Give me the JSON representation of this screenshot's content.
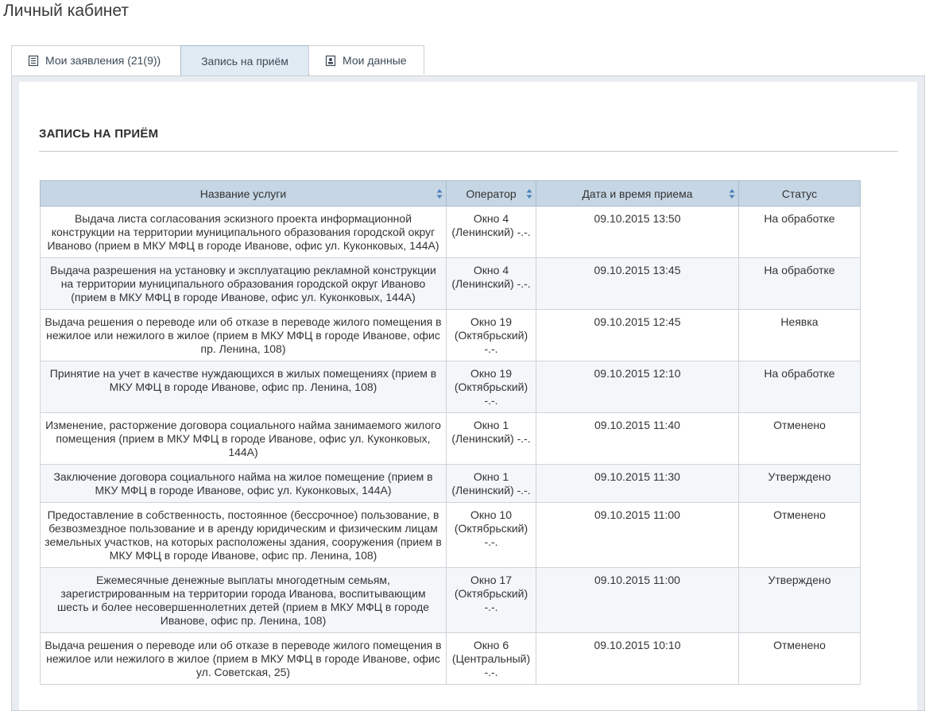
{
  "page": {
    "title": "Личный кабинет"
  },
  "tabs": [
    {
      "label": "Мои заявления (21(9))",
      "icon": "document-list-icon",
      "active": false
    },
    {
      "label": "Запись на приём",
      "icon": "",
      "active": true
    },
    {
      "label": "Мои данные",
      "icon": "id-card-icon",
      "active": false
    }
  ],
  "section": {
    "title": "ЗАПИСЬ НА ПРИЁМ"
  },
  "table": {
    "headers": [
      {
        "label": "Название услуги",
        "sortable": true
      },
      {
        "label": "Оператор",
        "sortable": true
      },
      {
        "label": "Дата и время приема",
        "sortable": true
      },
      {
        "label": "Статус",
        "sortable": false
      }
    ],
    "rows": [
      {
        "service": "Выдача листа согласования эскизного проекта информационной конструкции на территории муниципального образования городской округ Иваново (прием в МКУ МФЦ в городе Иванове, офис ул. Куконковых, 144А)",
        "operator": "Окно 4 (Ленинский) -.-.",
        "datetime": "09.10.2015 13:50",
        "status": "На обработке"
      },
      {
        "service": "Выдача разрешения на установку и эксплуатацию рекламной конструкции на территории муниципального образования городской округ Иваново (прием в МКУ МФЦ в городе Иванове, офис ул. Куконковых, 144А)",
        "operator": "Окно 4 (Ленинский) -.-.",
        "datetime": "09.10.2015 13:45",
        "status": "На обработке"
      },
      {
        "service": "Выдача решения о переводе или об отказе в переводе жилого помещения в нежилое или нежилого в жилое (прием в МКУ МФЦ в городе Иванове, офис пр. Ленина, 108)",
        "operator": "Окно 19 (Октябрьский) -.-.",
        "datetime": "09.10.2015 12:45",
        "status": "Неявка"
      },
      {
        "service": "Принятие на учет в качестве нуждающихся в жилых помещениях (прием в МКУ МФЦ в городе Иванове, офис пр. Ленина, 108)",
        "operator": "Окно 19 (Октябрьский) -.-.",
        "datetime": "09.10.2015 12:10",
        "status": "На обработке"
      },
      {
        "service": "Изменение, расторжение договора социального найма занимаемого жилого помещения (прием в МКУ МФЦ в городе Иванове, офис ул. Куконковых, 144А)",
        "operator": "Окно 1 (Ленинский) -.-.",
        "datetime": "09.10.2015 11:40",
        "status": "Отменено"
      },
      {
        "service": "Заключение договора социального найма на жилое помещение (прием в МКУ МФЦ в городе Иванове, офис ул. Куконковых, 144А)",
        "operator": "Окно 1 (Ленинский) -.-.",
        "datetime": "09.10.2015 11:30",
        "status": "Утверждено"
      },
      {
        "service": "Предоставление в собственность, постоянное (бессрочное) пользование, в безвозмездное пользование и в аренду юридическим и физическим лицам земельных участков, на которых расположены здания, сооружения (прием в МКУ МФЦ в городе Иванове, офис пр. Ленина, 108)",
        "operator": "Окно 10 (Октябрьский) -.-.",
        "datetime": "09.10.2015 11:00",
        "status": "Отменено"
      },
      {
        "service": "Ежемесячные денежные выплаты многодетным семьям, зарегистрированным на территории города Иванова, воспитывающим шесть и более несовершеннолетних детей (прием в МКУ МФЦ в городе Иванове, офис пр. Ленина, 108)",
        "operator": "Окно 17 (Октябрьский) -.-.",
        "datetime": "09.10.2015 11:00",
        "status": "Утверждено"
      },
      {
        "service": "Выдача решения о переводе или об отказе в переводе жилого помещения в нежилое или нежилого в жилое (прием в МКУ МФЦ в городе Иванове, офис ул. Советская, 25)",
        "operator": "Окно 6 (Центральный) -.-.",
        "datetime": "09.10.2015 10:10",
        "status": "Отменено"
      }
    ]
  },
  "colors": {
    "header_bg": "#c6d6e4",
    "tab_active_bg": "#e1ebf3",
    "sort_icon": "#4a82bc"
  }
}
